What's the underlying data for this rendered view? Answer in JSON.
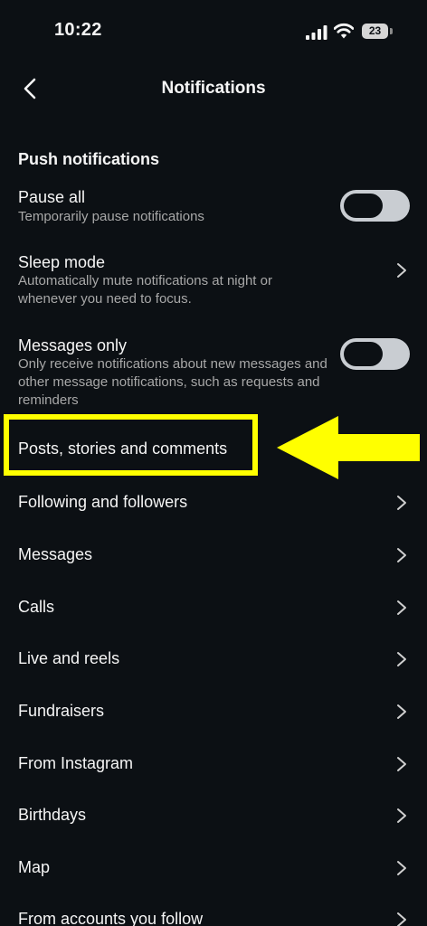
{
  "status_bar": {
    "time": "10:22",
    "battery": "23"
  },
  "nav": {
    "title": "Notifications"
  },
  "section": {
    "header": "Push notifications"
  },
  "settings": {
    "pause_all": {
      "title": "Pause all",
      "subtitle": "Temporarily pause notifications",
      "enabled": false
    },
    "sleep_mode": {
      "title": "Sleep mode",
      "subtitle": "Automatically mute notifications at night or whenever you need to focus."
    },
    "messages_only": {
      "title": "Messages only",
      "subtitle": "Only receive notifications about new messages and other message notifications, such as requests and reminders",
      "enabled": false
    }
  },
  "menu_items": [
    "Posts, stories and comments",
    "Following and followers",
    "Messages",
    "Calls",
    "Live and reels",
    "Fundraisers",
    "From Instagram",
    "Birthdays",
    "Map",
    "From accounts you follow"
  ],
  "colors": {
    "background": "#0c1014",
    "highlight": "#ffff00",
    "toggle_track": "#c9cdd2",
    "secondary_text": "#a8a8a8"
  }
}
